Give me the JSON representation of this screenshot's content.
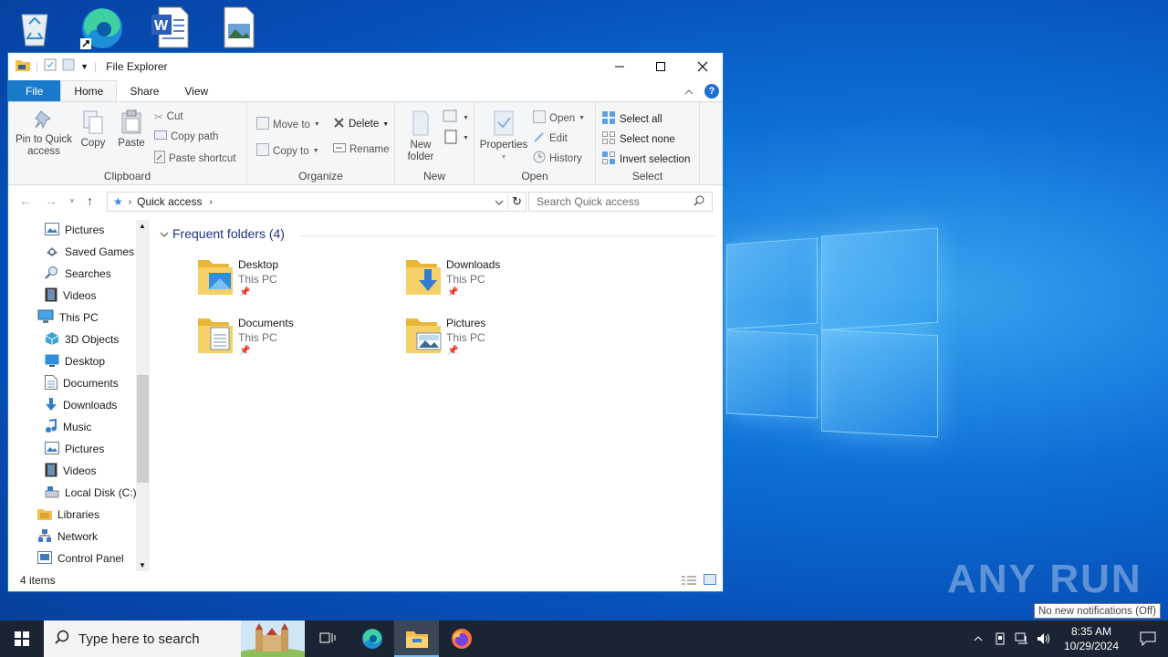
{
  "desktop": {
    "icons": [
      "recycle-bin-icon",
      "edge-shortcut-icon",
      "word-document-icon",
      "image-file-icon"
    ]
  },
  "window": {
    "title": "File Explorer",
    "tabs": {
      "file": "File",
      "home": "Home",
      "share": "Share",
      "view": "View"
    },
    "ribbon": {
      "clipboard": {
        "label": "Clipboard",
        "pin_line1": "Pin to Quick",
        "pin_line2": "access",
        "copy": "Copy",
        "paste": "Paste",
        "cut": "Cut",
        "copy_path": "Copy path",
        "paste_shortcut": "Paste shortcut"
      },
      "organize": {
        "label": "Organize",
        "move_to": "Move to",
        "copy_to": "Copy to",
        "delete": "Delete",
        "rename": "Rename"
      },
      "new": {
        "label": "New",
        "new_line1": "New",
        "new_line2": "folder"
      },
      "open": {
        "label": "Open",
        "properties": "Properties",
        "open": "Open",
        "edit": "Edit",
        "history": "History"
      },
      "select": {
        "label": "Select",
        "select_all": "Select all",
        "select_none": "Select none",
        "invert": "Invert selection"
      }
    },
    "address": {
      "crumb": "Quick access"
    },
    "search": {
      "placeholder": "Search Quick access"
    },
    "nav_items": [
      {
        "label": "Pictures",
        "icon": "pictures-icon"
      },
      {
        "label": "Saved Games",
        "icon": "saved-games-icon"
      },
      {
        "label": "Searches",
        "icon": "searches-icon"
      },
      {
        "label": "Videos",
        "icon": "videos-icon"
      },
      {
        "label": "This PC",
        "icon": "this-pc-icon"
      },
      {
        "label": "3D Objects",
        "icon": "3d-objects-icon"
      },
      {
        "label": "Desktop",
        "icon": "desktop-icon"
      },
      {
        "label": "Documents",
        "icon": "documents-icon"
      },
      {
        "label": "Downloads",
        "icon": "downloads-icon"
      },
      {
        "label": "Music",
        "icon": "music-icon"
      },
      {
        "label": "Pictures",
        "icon": "pictures-icon"
      },
      {
        "label": "Videos",
        "icon": "videos-icon"
      },
      {
        "label": "Local Disk (C:)",
        "icon": "local-disk-icon"
      },
      {
        "label": "Libraries",
        "icon": "libraries-icon"
      },
      {
        "label": "Network",
        "icon": "network-icon"
      },
      {
        "label": "Control Panel",
        "icon": "control-panel-icon"
      }
    ],
    "content": {
      "group_header": "Frequent folders (4)",
      "folders": [
        {
          "name": "Desktop",
          "location": "This PC"
        },
        {
          "name": "Downloads",
          "location": "This PC"
        },
        {
          "name": "Documents",
          "location": "This PC"
        },
        {
          "name": "Pictures",
          "location": "This PC"
        }
      ]
    },
    "status": {
      "item_count": "4 items"
    }
  },
  "notification_tip": "No new notifications (Off)",
  "watermark": "ANY RUN",
  "taskbar": {
    "search_placeholder": "Type here to search",
    "time": "8:35 AM",
    "date": "10/29/2024"
  }
}
